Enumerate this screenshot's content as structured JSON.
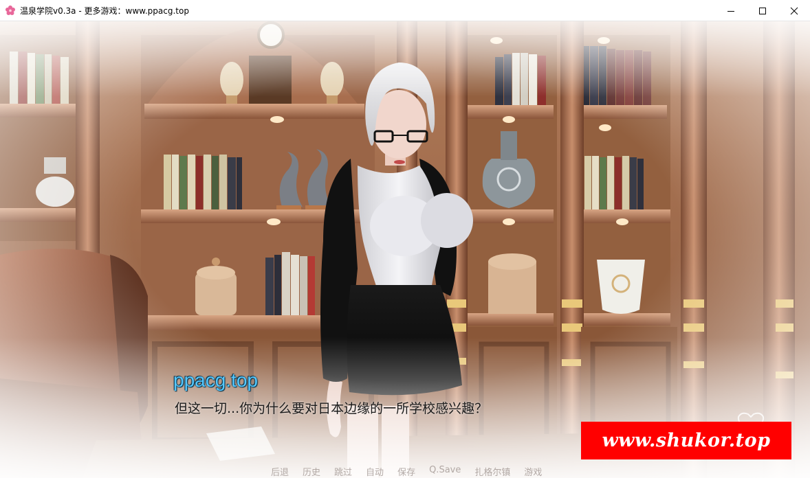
{
  "window": {
    "title": "温泉学院v0.3a - 更多游戏：www.ppacg.top",
    "icon": "sakura-icon",
    "controls": [
      "minimize-icon",
      "maximize-icon",
      "close-icon"
    ]
  },
  "dialogue": {
    "speaker": "ppacg.top",
    "text": "但这一切...你为什么要对日本边缘的一所学校感兴趣？"
  },
  "quick_menu": {
    "items": [
      {
        "label": "后退"
      },
      {
        "label": "历史"
      },
      {
        "label": "跳过"
      },
      {
        "label": "自动"
      },
      {
        "label": "保存"
      },
      {
        "label": "Q.Save"
      },
      {
        "label": "扎格尔镇"
      },
      {
        "label": "游戏"
      }
    ]
  },
  "watermark": {
    "text": "www.shukor.top",
    "color": "#ff0000"
  },
  "colors": {
    "speaker": "#57c8ff",
    "wood": "#8a5a3c",
    "banner": "#ff0000"
  }
}
